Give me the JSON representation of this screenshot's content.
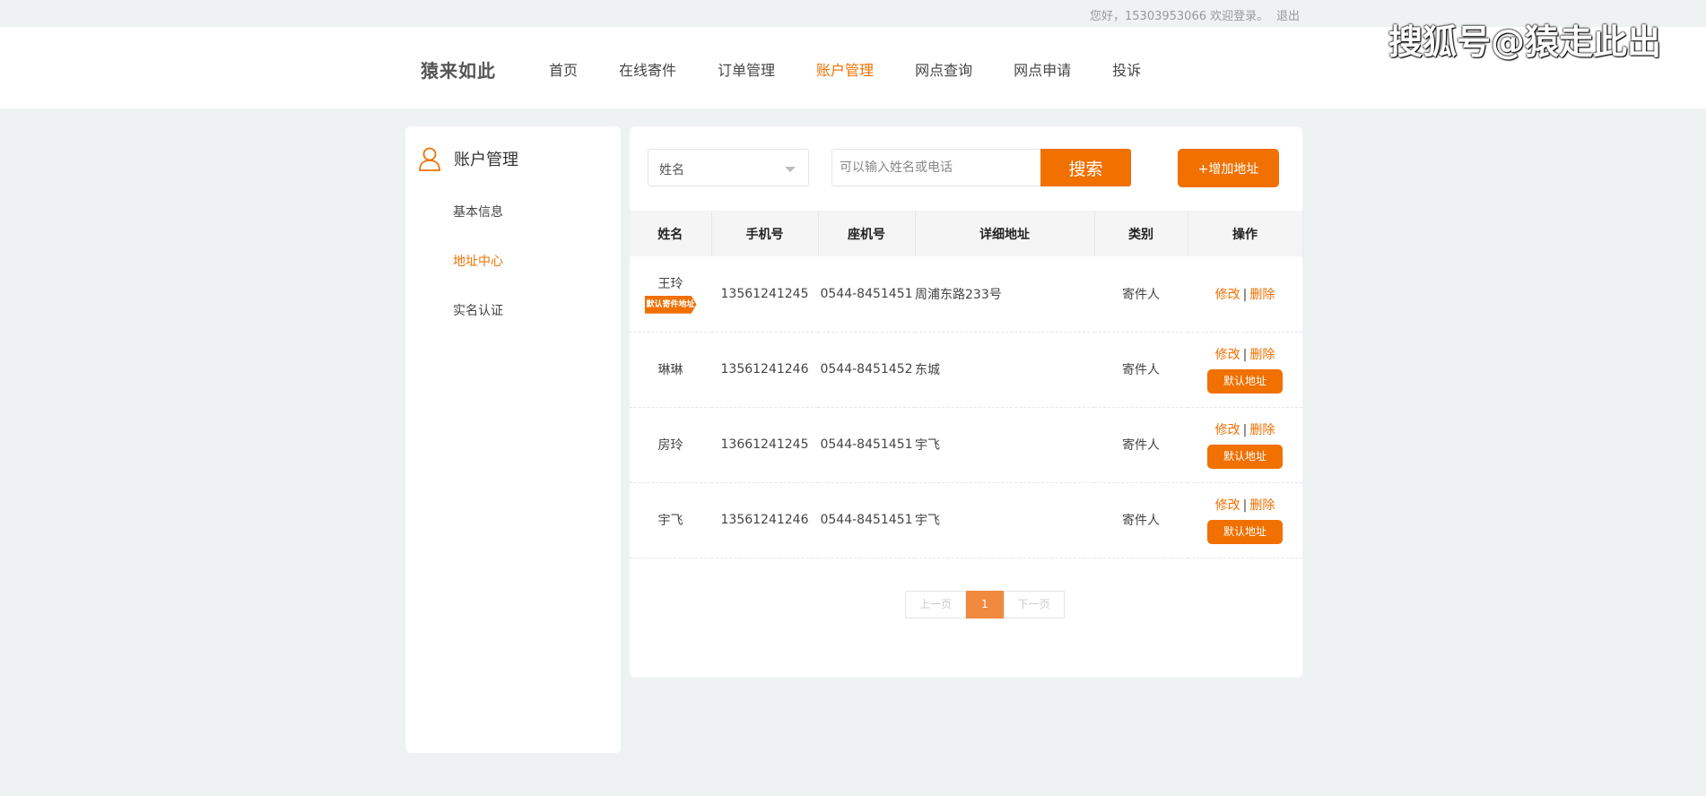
{
  "topbar": {
    "greeting": "您好，15303953066 欢迎登录。",
    "logout": "退出"
  },
  "header": {
    "logo": "猿来如此",
    "nav": [
      {
        "label": "首页",
        "active": false
      },
      {
        "label": "在线寄件",
        "active": false
      },
      {
        "label": "订单管理",
        "active": false
      },
      {
        "label": "账户管理",
        "active": true
      },
      {
        "label": "网点查询",
        "active": false
      },
      {
        "label": "网点申请",
        "active": false
      },
      {
        "label": "投诉",
        "active": false
      }
    ]
  },
  "watermark": "搜狐号@猿走此出",
  "sidebar": {
    "title": "账户管理",
    "items": [
      {
        "label": "基本信息",
        "active": false
      },
      {
        "label": "地址中心",
        "active": true
      },
      {
        "label": "实名认证",
        "active": false
      }
    ]
  },
  "search": {
    "field_select": "姓名",
    "placeholder": "可以输入姓名或电话",
    "button": "搜索",
    "add_button": "+增加地址"
  },
  "table": {
    "columns": [
      "姓名",
      "手机号",
      "座机号",
      "详细地址",
      "类别",
      "操作"
    ],
    "rows": [
      {
        "name": "王玲",
        "mobile": "13561241245",
        "landline": "0544-8451451",
        "address": "周浦东路233号",
        "category": "寄件人",
        "edit": "修改",
        "sep": "|",
        "delete": "删除",
        "default_badge": "默认寄件地址",
        "default_btn": ""
      },
      {
        "name": "琳琳",
        "mobile": "13561241246",
        "landline": "0544-8451452",
        "address": "东城",
        "category": "寄件人",
        "edit": "修改",
        "sep": "|",
        "delete": "删除",
        "default_badge": "",
        "default_btn": "默认地址"
      },
      {
        "name": "房玲",
        "mobile": "13661241245",
        "landline": "0544-8451451",
        "address": "宇飞",
        "category": "寄件人",
        "edit": "修改",
        "sep": "|",
        "delete": "删除",
        "default_badge": "",
        "default_btn": "默认地址"
      },
      {
        "name": "宇飞",
        "mobile": "13561241246",
        "landline": "0544-8451451",
        "address": "宇飞",
        "category": "寄件人",
        "edit": "修改",
        "sep": "|",
        "delete": "删除",
        "default_badge": "",
        "default_btn": "默认地址"
      }
    ]
  },
  "pagination": {
    "prev": "上一页",
    "current": "1",
    "next": "下一页"
  },
  "colors": {
    "accent": "#f07000",
    "page_bg": "#eff2f2",
    "pager_current": "#f08a3e"
  }
}
